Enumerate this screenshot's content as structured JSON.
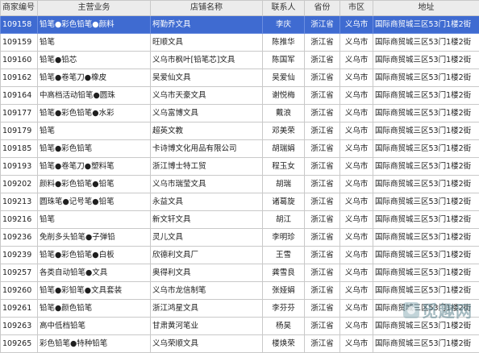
{
  "headers": [
    "商家编号",
    "主营业务",
    "店铺名称",
    "联系人",
    "省份",
    "市区",
    "地址"
  ],
  "rows": [
    {
      "id": "109158",
      "business": "铅笔●彩色铅笔●颜料",
      "shop": "柯勤乔文具",
      "contact": "李庆",
      "province": "浙江省",
      "city": "义乌市",
      "address": "国际商贸城三区53门1楼2街"
    },
    {
      "id": "109159",
      "business": "铅笔",
      "shop": "旺顺文具",
      "contact": "陈推华",
      "province": "浙江省",
      "city": "义乌市",
      "address": "国际商贸城三区53门1楼2街"
    },
    {
      "id": "109160",
      "business": "铅笔●铅芯",
      "shop": "义乌市枫叶[铅笔芯]文具",
      "contact": "陈国军",
      "province": "浙江省",
      "city": "义乌市",
      "address": "国际商贸城三区53门1楼2街"
    },
    {
      "id": "109162",
      "business": "铅笔●卷笔刀●橡皮",
      "shop": "吴爱仙文具",
      "contact": "吴爱仙",
      "province": "浙江省",
      "city": "义乌市",
      "address": "国际商贸城三区53门1楼2街"
    },
    {
      "id": "109164",
      "business": "中高档活动铅笔●圆珠",
      "shop": "义乌市天豪文具",
      "contact": "谢悦梅",
      "province": "浙江省",
      "city": "义乌市",
      "address": "国际商贸城三区53门1楼2街"
    },
    {
      "id": "109177",
      "business": "铅笔●彩色铅笔●水彩",
      "shop": "义乌富博文具",
      "contact": "戴浪",
      "province": "浙江省",
      "city": "义乌市",
      "address": "国际商贸城三区53门1楼2街"
    },
    {
      "id": "109179",
      "business": "铅笔",
      "shop": "超英文教",
      "contact": "邓美荣",
      "province": "浙江省",
      "city": "义乌市",
      "address": "国际商贸城三区53门1楼2街"
    },
    {
      "id": "109185",
      "business": "铅笔●彩色铅笔",
      "shop": "卡诗博文化用品有限公司",
      "contact": "胡瑞娟",
      "province": "浙江省",
      "city": "义乌市",
      "address": "国际商贸城三区53门1楼2街"
    },
    {
      "id": "109193",
      "business": "铅笔●卷笔刀●塑料笔",
      "shop": "浙江博士特工贸",
      "contact": "程玉女",
      "province": "浙江省",
      "city": "义乌市",
      "address": "国际商贸城三区53门1楼2街"
    },
    {
      "id": "109202",
      "business": "颜料●彩色铅笔●铅笔",
      "shop": "义乌市瑞莹文具",
      "contact": "胡瑞",
      "province": "浙江省",
      "city": "义乌市",
      "address": "国际商贸城三区53门1楼2街"
    },
    {
      "id": "109213",
      "business": "圆珠笔●记号笔●铅笔",
      "shop": "永益文具",
      "contact": "诸葛旋",
      "province": "浙江省",
      "city": "义乌市",
      "address": "国际商贸城三区53门1楼2街"
    },
    {
      "id": "109216",
      "business": "铅笔",
      "shop": "新文轩文具",
      "contact": "胡江",
      "province": "浙江省",
      "city": "义乌市",
      "address": "国际商贸城三区53门1楼2街"
    },
    {
      "id": "109236",
      "business": "免削多头铅笔●子弹铅",
      "shop": "灵儿文具",
      "contact": "李明珍",
      "province": "浙江省",
      "city": "义乌市",
      "address": "国际商贸城三区53门1楼2街"
    },
    {
      "id": "109239",
      "business": "铅笔●彩色铅笔●白板",
      "shop": "欣德利文具厂",
      "contact": "王雪",
      "province": "浙江省",
      "city": "义乌市",
      "address": "国际商贸城三区53门1楼2街"
    },
    {
      "id": "109257",
      "business": "各类自动铅笔●文具",
      "shop": "奥得利文具",
      "contact": "龚雪良",
      "province": "浙江省",
      "city": "义乌市",
      "address": "国际商贸城三区53门1楼2街"
    },
    {
      "id": "109260",
      "business": "铅笔●彩铅笔●文具套装",
      "shop": "义乌市龙信制笔",
      "contact": "张娅娟",
      "province": "浙江省",
      "city": "义乌市",
      "address": "国际商贸城三区53门1楼2街"
    },
    {
      "id": "109261",
      "business": "铅笔●颜色铅笔",
      "shop": "浙江鸿星文具",
      "contact": "李芬芬",
      "province": "浙江省",
      "city": "义乌市",
      "address": "国际商贸城三区53门1楼2街"
    },
    {
      "id": "109263",
      "business": "高中低档铅笔",
      "shop": "甘肃黄河笔业",
      "contact": "杨昊",
      "province": "浙江省",
      "city": "义乌市",
      "address": "国际商贸城三区53门1楼2街"
    },
    {
      "id": "109265",
      "business": "彩色铅笔●特种铅笔",
      "shop": "义乌荣顺文具",
      "contact": "楼焕荣",
      "province": "浙江省",
      "city": "义乌市",
      "address": "国际商贸城三区53门1楼2街"
    }
  ],
  "watermark": "觅趣网"
}
